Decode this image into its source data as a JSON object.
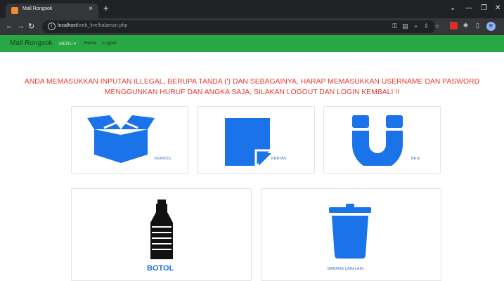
{
  "browser": {
    "tab_title": "Mall Rongsok",
    "tab_close": "×",
    "new_tab": "+",
    "url_host": "localhost",
    "url_path": "/web_live/halaman.php",
    "profile_initial": "R"
  },
  "navbar": {
    "brand": "Mall Rongsok",
    "menu_label": "MENU ▾",
    "home_label": "Home",
    "logout_label": "Logout"
  },
  "alert": {
    "line1": "ANDA MEMASUKKAN INPUTAN ILLEGAL, BERUPA TANDA (') DAN SEBAGAINYA, HARAP MEMASUKKAN USERNAME DAN PASWORD",
    "line2": "MENGGUNKAN HURUF DAN ANGKA SAJA, SILAKAN LOGOUT DAN LOGIN KEMBALI !!"
  },
  "categories": [
    {
      "label": "KERDUS",
      "icon": "box-icon"
    },
    {
      "label": "KERTAS",
      "icon": "paper-icon"
    },
    {
      "label": "BESI",
      "icon": "magnet-icon"
    },
    {
      "label": "BOTOL",
      "icon": "bottle-icon"
    },
    {
      "label": "BARANG LAIN-LAIN",
      "icon": "trash-bin-icon"
    }
  ],
  "colors": {
    "accent_blue": "#1a73e8",
    "navbar_green": "#28a745",
    "alert_red": "#e8382f"
  }
}
